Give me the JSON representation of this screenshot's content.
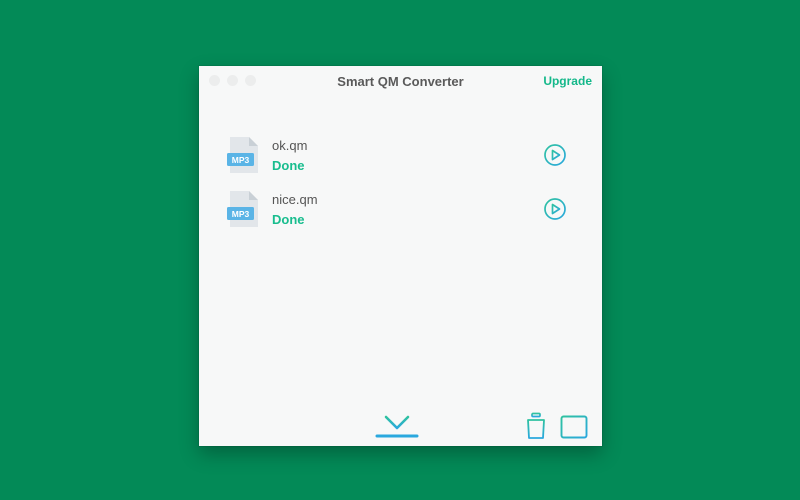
{
  "window": {
    "title": "Smart QM Converter",
    "upgrade_label": "Upgrade"
  },
  "files": [
    {
      "name": "ok.qm",
      "status": "Done",
      "badge": "MP3"
    },
    {
      "name": "nice.qm",
      "status": "Done",
      "badge": "MP3"
    }
  ],
  "icons": {
    "file": "mp3-file-icon",
    "play": "play-circle-icon",
    "import": "download-arrow-icon",
    "trash": "trash-icon",
    "folder": "folder-icon"
  },
  "colors": {
    "background": "#038a57",
    "window": "#f7f8f8",
    "accent": "#18bd8e",
    "icon_gradient_start": "#2fc2a0",
    "icon_gradient_end": "#2aa8de",
    "file_badge": "#5ab4e6"
  }
}
